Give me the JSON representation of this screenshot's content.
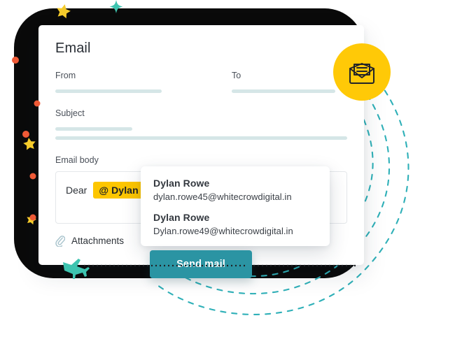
{
  "card": {
    "title": "Email",
    "fields": {
      "from_label": "From",
      "to_label": "To",
      "subject_label": "Subject",
      "body_label": "Email body"
    },
    "body": {
      "greeting": "Dear",
      "mention_chip": "@ Dylan"
    },
    "attachments_label": "Attachments"
  },
  "dropdown": {
    "suggestions": [
      {
        "name": "Dylan Rowe",
        "email": "dylan.rowe45@whitecrowdigital.in"
      },
      {
        "name": "Dylan Rowe",
        "email": "Dylan.rowe49@whitecrowdigital.in"
      }
    ]
  },
  "actions": {
    "send_label": "Send mail"
  },
  "icons": {
    "envelope": "envelope-open-icon",
    "paperclip": "paperclip-icon",
    "airplane": "paper-airplane-icon",
    "sparkle": "sparkle-icon",
    "star": "star-icon",
    "dot": "dot-icon"
  },
  "colors": {
    "accent_teal": "#2b94a3",
    "badge_yellow": "#ffc907",
    "chip_yellow": "#fdc600",
    "placeholder_bar": "#d5e6e7",
    "backdrop_dark": "#0a0a0a",
    "dot_orange": "#ef5a36",
    "star_yellow": "#f7cf2c",
    "dash_teal": "#2fb0b8"
  }
}
